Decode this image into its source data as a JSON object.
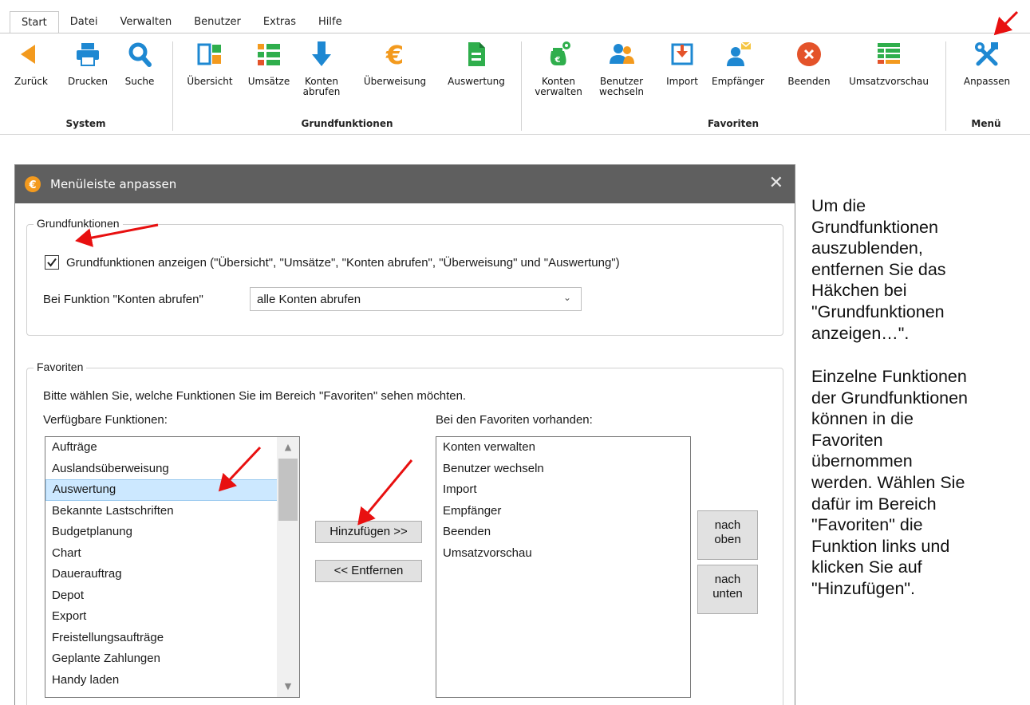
{
  "ribbon": {
    "tabs": [
      "Start",
      "Datei",
      "Verwalten",
      "Benutzer",
      "Extras",
      "Hilfe"
    ],
    "groups": {
      "system": {
        "title": "System",
        "buttons": {
          "back": "Zurück",
          "print": "Drucken",
          "search": "Suche"
        }
      },
      "grundfunktionen": {
        "title": "Grundfunktionen",
        "buttons": {
          "overview": "Übersicht",
          "umsaetze": "Umsätze",
          "konten_abrufen_1": "Konten",
          "konten_abrufen_2": "abrufen",
          "ueberweisung": "Überweisung",
          "auswertung": "Auswertung"
        }
      },
      "favoriten": {
        "title": "Favoriten",
        "buttons": {
          "konten_verwalten_1": "Konten",
          "konten_verwalten_2": "verwalten",
          "benutzer_wechseln_1": "Benutzer",
          "benutzer_wechseln_2": "wechseln",
          "import": "Import",
          "empfaenger": "Empfänger",
          "beenden": "Beenden",
          "umsatzvorschau": "Umsatzvorschau"
        }
      },
      "menu": {
        "title": "Menü",
        "buttons": {
          "anpassen": "Anpassen"
        }
      }
    },
    "icon_names": [
      "arrow-left-icon",
      "printer-icon",
      "magnifier-icon",
      "overview-icon",
      "list-icon",
      "download-arrow-icon",
      "euro-icon",
      "document-icon",
      "money-bag-gear-icon",
      "users-icon",
      "import-icon",
      "user-mail-icon",
      "close-circle-icon",
      "table-grid-icon",
      "tools-icon"
    ]
  },
  "dialog": {
    "title": "Menüleiste anpassen",
    "grundfunktionen": {
      "legend": "Grundfunktionen",
      "checkbox_label": "Grundfunktionen anzeigen (\"Übersicht\", \"Umsätze\", \"Konten abrufen\", \"Überweisung\" und \"Auswertung\")",
      "checked": true,
      "combo_label": "Bei Funktion \"Konten abrufen\"",
      "combo_value": "alle Konten abrufen"
    },
    "favoriten": {
      "legend": "Favoriten",
      "hint": "Bitte wählen Sie, welche Funktionen Sie im Bereich \"Favoriten\" sehen möchten.",
      "available_label": "Verfügbare Funktionen:",
      "present_label": "Bei den Favoriten vorhanden:",
      "available": [
        "Aufträge",
        "Auslandsüberweisung",
        "Auswertung",
        "Bekannte Lastschriften",
        "Budgetplanung",
        "Chart",
        "Dauerauftrag",
        "Depot",
        "Export",
        "Freistellungsaufträge",
        "Geplante Zahlungen",
        "Handy laden"
      ],
      "selected_available": "Auswertung",
      "present": [
        "Konten verwalten",
        "Benutzer wechseln",
        "Import",
        "Empfänger",
        "Beenden",
        "Umsatzvorschau"
      ],
      "add_button": "Hinzufügen >>",
      "remove_button": "<< Entfernen",
      "up_button_1": "nach",
      "up_button_2": "oben",
      "down_button_1": "nach",
      "down_button_2": "unten"
    }
  },
  "help": {
    "paragraph1": [
      "Um die",
      "Grundfunktionen",
      "auszublenden,",
      "entfernen Sie das",
      "Häkchen bei",
      "\"Grundfunktionen",
      "anzeigen…\"."
    ],
    "paragraph2": [
      "Einzelne Funktionen",
      "der Grundfunktionen",
      "können in die",
      "Favoriten",
      "übernommen",
      "werden. Wählen Sie",
      "dafür im Bereich",
      "\"Favoriten\" die",
      "Funktion links und",
      "klicken Sie auf",
      "\"Hinzufügen\"."
    ]
  },
  "colors": {
    "accent_orange": "#f39a1e",
    "ribbon_blue": "#1e88d2",
    "ribbon_green": "#2fae4c",
    "close_red": "#e4532a",
    "annotation_red": "#e81010",
    "titlebar": "#5f5f5f",
    "list_selection": "#cce8ff"
  }
}
